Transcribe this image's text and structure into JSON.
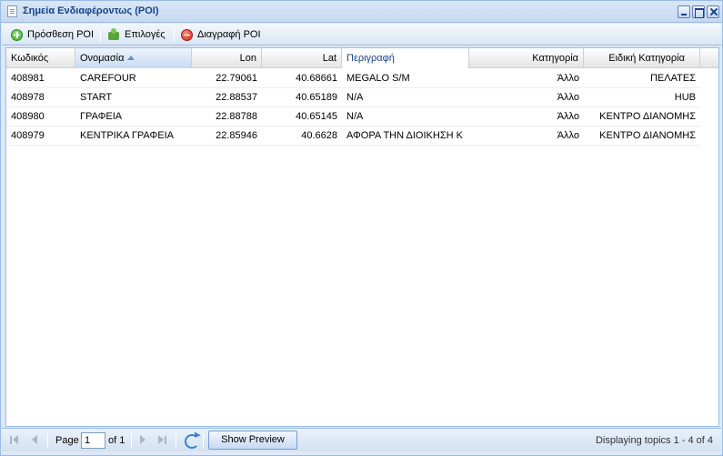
{
  "window": {
    "title": "Σημεία Ενδιαφέροντως (POI)"
  },
  "toolbar": {
    "add_label": "Πρόσθεση POI",
    "options_label": "Επιλογές",
    "delete_label": "Διαγραφή POI"
  },
  "grid": {
    "columns": {
      "code": "Κωδικός",
      "name": "Ονομασία",
      "lon": "Lon",
      "lat": "Lat",
      "description": "Περιγραφή",
      "category": "Κατηγορία",
      "special_category": "Ειδική Κατηγορία"
    },
    "sorted_column": "name",
    "rows": [
      {
        "code": "408981",
        "name": "CAREFOUR",
        "lon": "22.79061",
        "lat": "40.68661",
        "description": "MEGALO S/M",
        "category": "Άλλο",
        "special_category": "ΠΕΛΑΤΕΣ"
      },
      {
        "code": "408978",
        "name": "START",
        "lon": "22.88537",
        "lat": "40.65189",
        "description": "N/A",
        "category": "Άλλο",
        "special_category": "HUB"
      },
      {
        "code": "408980",
        "name": "ΓΡΑΦΕΙΑ",
        "lon": "22.88788",
        "lat": "40.65145",
        "description": "N/A",
        "category": "Άλλο",
        "special_category": "ΚΕΝΤΡΟ ΔΙΑΝΟΜΗΣ"
      },
      {
        "code": "408979",
        "name": "ΚΕΝΤΡΙΚΑ ΓΡΑΦΕΙΑ",
        "lon": "22.85946",
        "lat": "40.6628",
        "description": "ΑΦΟΡΑ ΤΗΝ ΔΙΟΙΚΗΣΗ Κ",
        "category": "Άλλο",
        "special_category": "ΚΕΝΤΡΟ ΔΙΑΝΟΜΗΣ"
      }
    ]
  },
  "paging": {
    "page_label": "Page",
    "page_value": "1",
    "of_label": "of 1",
    "preview_label": "Show Preview",
    "info": "Displaying topics 1 - 4 of 4"
  }
}
